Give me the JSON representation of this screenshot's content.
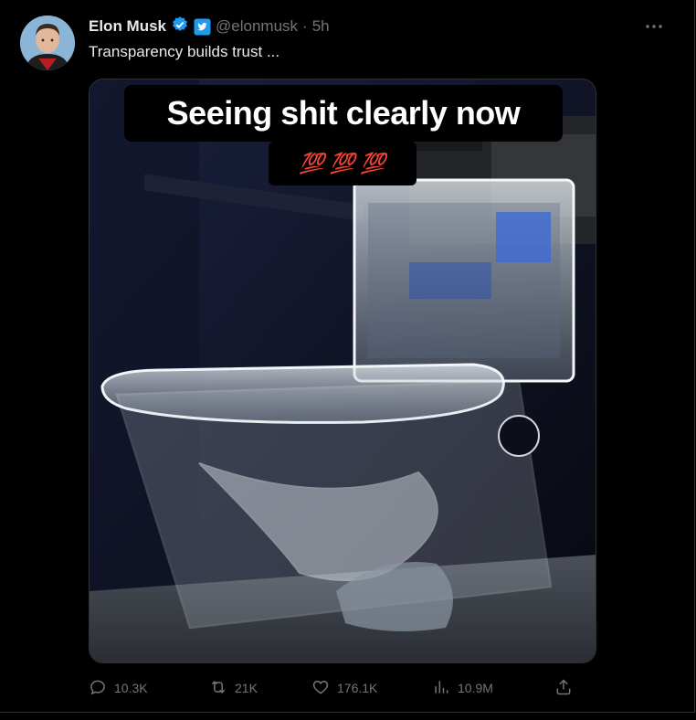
{
  "tweet": {
    "author_name": "Elon Musk",
    "handle": "@elonmusk",
    "separator": "·",
    "time": "5h",
    "more_icon": "more-icon",
    "text": "Transparency builds trust ...",
    "media": {
      "caption": "Seeing shit clearly now",
      "emoji_line": "💯 💯 💯"
    },
    "stats": {
      "replies": "10.3K",
      "reposts": "21K",
      "likes": "176.1K",
      "views": "10.9M"
    }
  },
  "colors": {
    "background": "#000000",
    "verified_blue": "#1d9bf0",
    "secondary_text": "#71767b"
  }
}
